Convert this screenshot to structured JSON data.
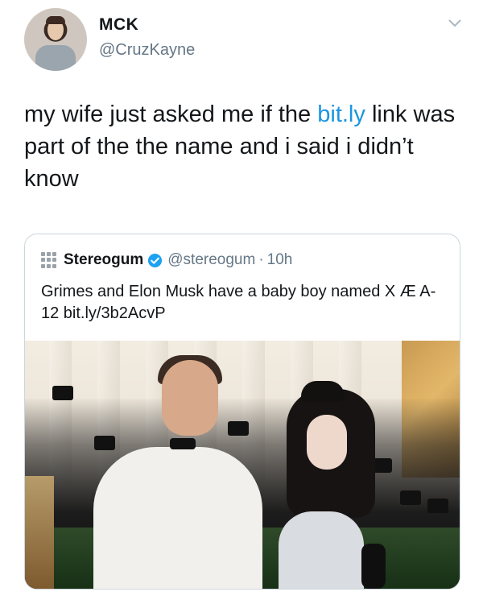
{
  "tweet": {
    "display_name": "MCK",
    "handle": "@CruzKayne",
    "text_before_link": "my wife just asked me if the ",
    "link_text": "bit.ly",
    "text_after_link": " link was part of the the name and i said i didn’t know"
  },
  "quote": {
    "name": "Stereogum",
    "handle": "@stereogum",
    "dot": "·",
    "time": "10h",
    "text": "Grimes and Elon Musk have a baby boy named X Æ A-12 bit.ly/3b2AcvP",
    "logo_icon": "stereogum-logo-icon",
    "verified_icon": "verified-badge-icon"
  },
  "icons": {
    "chevron": "chevron-down-icon"
  },
  "colors": {
    "link": "#1b95e0",
    "secondary_text": "#657786",
    "card_border": "#ccd6dd"
  }
}
